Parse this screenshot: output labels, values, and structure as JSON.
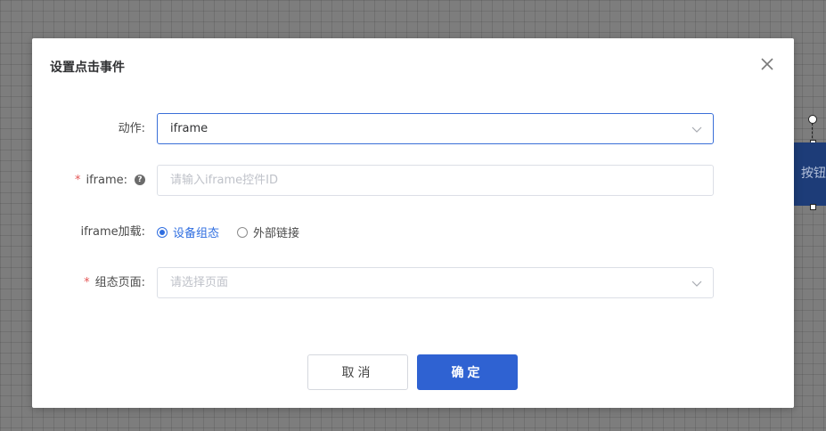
{
  "background": {
    "widget_label": "按钮"
  },
  "dialog": {
    "title": "设置点击事件",
    "close_icon": "close-icon",
    "form": {
      "action": {
        "label": "动作:",
        "value": "iframe"
      },
      "iframe": {
        "required_mark": "*",
        "label": "iframe:",
        "help_icon": "?",
        "placeholder": "请输入iframe控件ID"
      },
      "iframe_load": {
        "label": "iframe加载:",
        "options": [
          {
            "label": "设备组态",
            "checked": true
          },
          {
            "label": "外部链接",
            "checked": false
          }
        ]
      },
      "page": {
        "required_mark": "*",
        "label": "组态页面:",
        "placeholder": "请选择页面"
      }
    },
    "buttons": {
      "cancel": "取消",
      "confirm": "确定"
    }
  },
  "colors": {
    "primary": "#2f62d2",
    "radio_active": "#2f6ee0",
    "required": "#e45656",
    "widget": "#1d3c78"
  }
}
